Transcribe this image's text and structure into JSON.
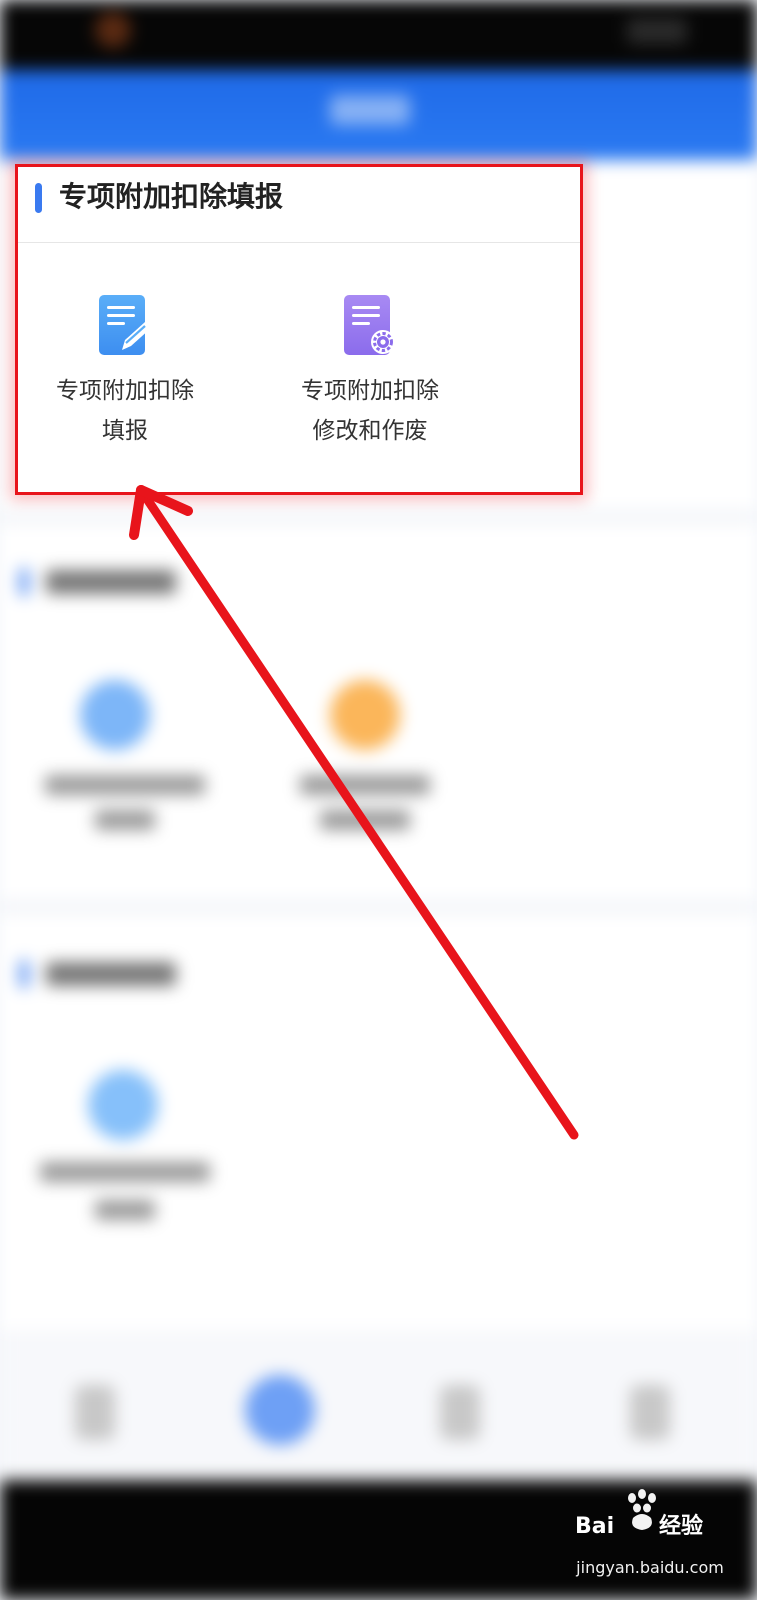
{
  "card": {
    "title": "专项附加扣除填报",
    "items": [
      {
        "label_line1": "专项附加扣除",
        "label_line2": "填报",
        "icon": "form-edit-icon",
        "icon_color": "#4da0f6"
      },
      {
        "label_line1": "专项附加扣除",
        "label_line2": "修改和作废",
        "icon": "form-settings-icon",
        "icon_color": "#9a7cf0"
      }
    ],
    "highlight_color": "#e8141b",
    "accent_color": "#3a7af0"
  },
  "annotation": {
    "arrow_color": "#e8141b"
  },
  "background": {
    "header_color": "#2b7af2",
    "blurred": true
  },
  "watermark": {
    "logo_text": "Baidu经验",
    "url": "jingyan.baidu.com"
  }
}
